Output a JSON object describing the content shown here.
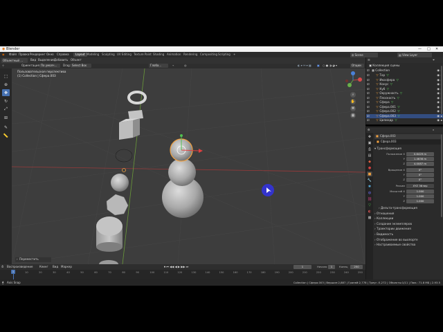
{
  "window": {
    "title": "Blender"
  },
  "menu": {
    "items": [
      "Файл",
      "Правка",
      "Рендеринг",
      "Окно",
      "Справка"
    ],
    "workspaces": [
      "Layout",
      "Modeling",
      "Sculpting",
      "UV Editing",
      "Texture Paint",
      "Shading",
      "Animation",
      "Rendering",
      "Compositing",
      "Scripting"
    ],
    "add_tab": "+",
    "scene_label": "Scene",
    "view_layer_label": "View Layer"
  },
  "header": {
    "mode": "Объектный ...",
    "menus": [
      "Вид",
      "Выделение",
      "Добавить",
      "Объект"
    ],
    "orientation_label": "Ориентация:",
    "orientation_value": "По умолч...",
    "drag_label": "Drag:",
    "drag_value": "Select Box",
    "pivot": "Глоба...",
    "options": "Опции"
  },
  "viewport": {
    "view_name": "Пользовательская перспектива",
    "collection_info": "(1) Collection | Сфера.003",
    "cursor_marker": "blue-cursor",
    "last_op": "Переместить"
  },
  "outliner": {
    "title": "Коллекция сцены",
    "collection": "Collection",
    "items": [
      {
        "name": "Тор",
        "selected": false
      },
      {
        "name": "Икосфера",
        "selected": false
      },
      {
        "name": "Конус",
        "selected": false
      },
      {
        "name": "Куб",
        "selected": false
      },
      {
        "name": "Окружность",
        "selected": false
      },
      {
        "name": "Плоскость",
        "selected": false
      },
      {
        "name": "Сфера",
        "selected": false
      },
      {
        "name": "Сфера.001",
        "selected": false
      },
      {
        "name": "Сфера.002",
        "selected": false
      },
      {
        "name": "Сфера.003",
        "selected": true
      },
      {
        "name": "Цилиндр",
        "selected": false
      }
    ]
  },
  "properties": {
    "object_name": "Сфера.003",
    "object_sub": "Сфера.003",
    "transform_title": "Трансформация",
    "location_label": "Положение X",
    "location": [
      "0.6429 m",
      "1.4636 m",
      "4.0087 m"
    ],
    "rotation_label": "Вращение X",
    "rotation": [
      "0°",
      "0°",
      "0°"
    ],
    "mode_label": "Режим",
    "mode_value": "XYZ Эйлер",
    "scale_label": "Масштаб X",
    "scale": [
      "1.000",
      "1.000",
      "1.000"
    ],
    "axis_y": "Y",
    "axis_z": "Z",
    "sections": [
      "Дельта-трансформация",
      "Отношения",
      "Коллекции",
      "Создание экземпляров",
      "Траектории движения",
      "Видимость",
      "Отображение во вьюпорте",
      "Настраиваемые свойства"
    ]
  },
  "timeline": {
    "menus": [
      "Воспроизведение",
      "Кеинг",
      "Вид",
      "Маркер"
    ],
    "current_frame": "1",
    "start_label": "Начало",
    "start": "1",
    "end_label": "Конец",
    "end": "250",
    "ruler": [
      "0",
      "10",
      "20",
      "30",
      "40",
      "50",
      "60",
      "70",
      "80",
      "90",
      "100",
      "110",
      "120",
      "130",
      "140",
      "150",
      "160",
      "170",
      "180",
      "190",
      "200",
      "210",
      "220",
      "230",
      "240",
      "250"
    ]
  },
  "status": {
    "left": "Axis Snap",
    "right": "Collection | Сфера.003 | Вершин:2,887 | Граней:2,778 | Треуг.:5,272 | Объекты:1/11 | Пам.: 71.8 МБ | 2.93.5"
  },
  "colors": {
    "accent": "#4772b3",
    "selection": "#f0a040",
    "bg_viewport": "#3d3d3d",
    "cursor": "#3333cc"
  }
}
